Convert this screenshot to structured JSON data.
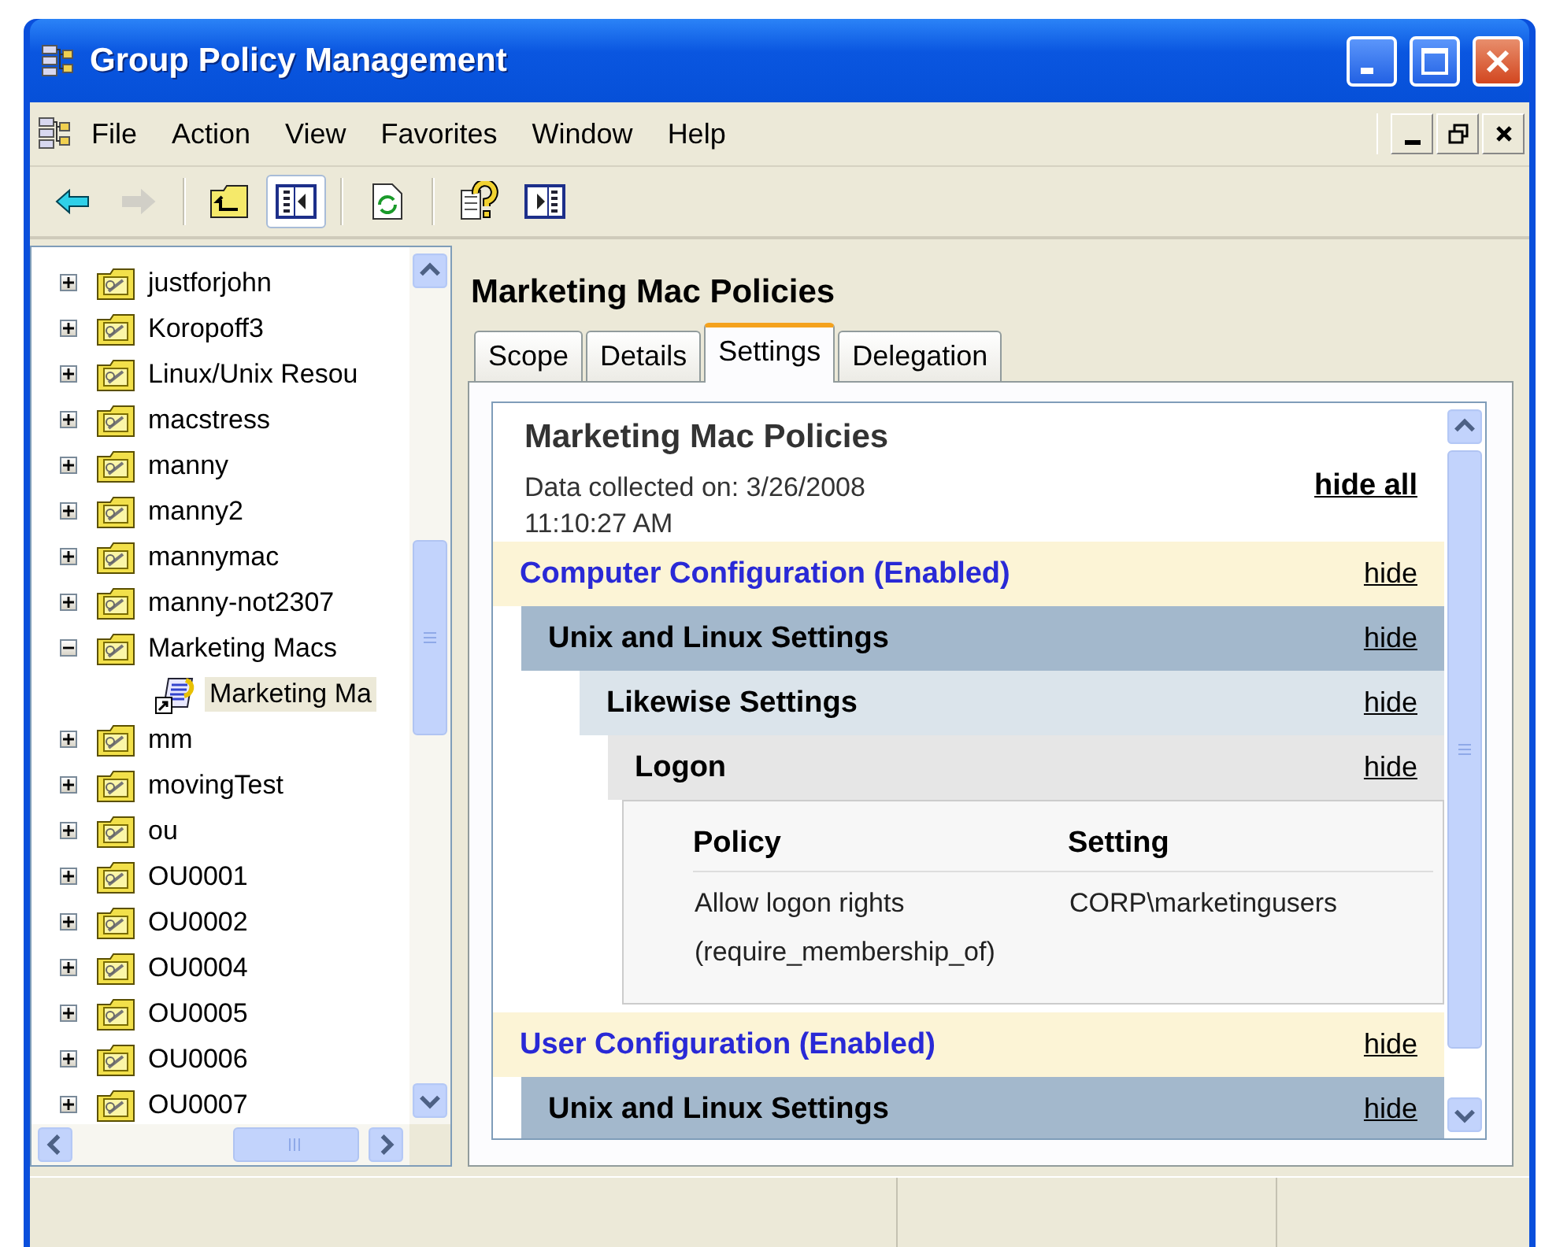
{
  "window": {
    "title": "Group Policy Management"
  },
  "menu": [
    "File",
    "Action",
    "View",
    "Favorites",
    "Window",
    "Help"
  ],
  "toolbar": [
    {
      "kind": "back",
      "disabled": false,
      "pressed": false
    },
    {
      "kind": "forward",
      "disabled": true,
      "pressed": false
    },
    {
      "kind": "separator"
    },
    {
      "kind": "up",
      "disabled": false,
      "pressed": false
    },
    {
      "kind": "tree",
      "disabled": false,
      "pressed": true
    },
    {
      "kind": "separator"
    },
    {
      "kind": "refresh",
      "disabled": false,
      "pressed": false
    },
    {
      "kind": "separator"
    },
    {
      "kind": "help",
      "disabled": false,
      "pressed": false
    },
    {
      "kind": "pane",
      "disabled": false,
      "pressed": false
    }
  ],
  "tree": {
    "items": [
      {
        "label": "justforjohn",
        "kind": "ou",
        "expanded": false,
        "selected": false
      },
      {
        "label": "Koropoff3",
        "kind": "ou",
        "expanded": false,
        "selected": false
      },
      {
        "label": "Linux/Unix Resou",
        "kind": "ou",
        "expanded": false,
        "selected": false
      },
      {
        "label": "macstress",
        "kind": "ou",
        "expanded": false,
        "selected": false
      },
      {
        "label": "manny",
        "kind": "ou",
        "expanded": false,
        "selected": false
      },
      {
        "label": "manny2",
        "kind": "ou",
        "expanded": false,
        "selected": false
      },
      {
        "label": "mannymac",
        "kind": "ou",
        "expanded": false,
        "selected": false
      },
      {
        "label": "manny-not2307",
        "kind": "ou",
        "expanded": false,
        "selected": false
      },
      {
        "label": "Marketing Macs",
        "kind": "ou",
        "expanded": true,
        "selected": false,
        "children": [
          {
            "label": "Marketing Ma",
            "kind": "link",
            "selected": true
          }
        ]
      },
      {
        "label": "mm",
        "kind": "ou",
        "expanded": false,
        "selected": false
      },
      {
        "label": "movingTest",
        "kind": "ou",
        "expanded": false,
        "selected": false
      },
      {
        "label": "ou",
        "kind": "ou",
        "expanded": false,
        "selected": false
      },
      {
        "label": "OU0001",
        "kind": "ou",
        "expanded": false,
        "selected": false
      },
      {
        "label": "OU0002",
        "kind": "ou",
        "expanded": false,
        "selected": false
      },
      {
        "label": "OU0004",
        "kind": "ou",
        "expanded": false,
        "selected": false
      },
      {
        "label": "OU0005",
        "kind": "ou",
        "expanded": false,
        "selected": false
      },
      {
        "label": "OU0006",
        "kind": "ou",
        "expanded": false,
        "selected": false
      },
      {
        "label": "OU0007",
        "kind": "ou",
        "expanded": false,
        "selected": false
      }
    ]
  },
  "details": {
    "title": "Marketing Mac Policies",
    "tabs": [
      {
        "label": "Scope",
        "selected": false
      },
      {
        "label": "Details",
        "selected": false
      },
      {
        "label": "Settings",
        "selected": true
      },
      {
        "label": "Delegation",
        "selected": false
      }
    ],
    "report": {
      "title": "Marketing Mac Policies",
      "collected": "Data collected on: 3/26/2008 11:10:27 AM",
      "hide_all": "hide all",
      "sections": [
        {
          "kind": "config",
          "title": "Computer Configuration (Enabled)",
          "action": "hide",
          "children": [
            {
              "kind": "extension",
              "title": "Unix and Linux Settings",
              "action": "hide",
              "children": [
                {
                  "kind": "folder",
                  "title": "Likewise Settings",
                  "action": "hide",
                  "children": [
                    {
                      "kind": "category",
                      "title": "Logon",
                      "action": "hide",
                      "table": {
                        "columns": [
                          "Policy",
                          "Setting"
                        ],
                        "rows": [
                          [
                            "Allow logon rights (require_membership_of)",
                            "CORP\\marketingusers"
                          ]
                        ]
                      }
                    }
                  ]
                }
              ]
            }
          ]
        },
        {
          "kind": "config",
          "title": "User Configuration (Enabled)",
          "action": "hide",
          "children": [
            {
              "kind": "extension",
              "title": "Unix and Linux Settings",
              "action": "hide"
            }
          ]
        }
      ]
    }
  }
}
